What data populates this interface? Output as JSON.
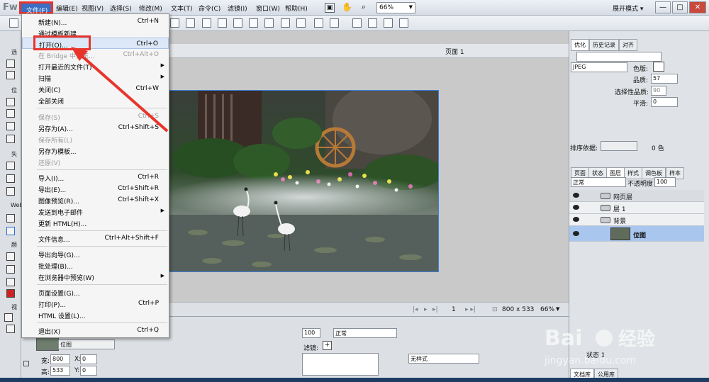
{
  "app": {
    "logo": "Fw"
  },
  "menubar": {
    "items": [
      {
        "label": "文件(F)"
      },
      {
        "label": "编辑(E)"
      },
      {
        "label": "视图(V)"
      },
      {
        "label": "选择(S)"
      },
      {
        "label": "修改(M)"
      },
      {
        "label": "文本(T)"
      },
      {
        "label": "命令(C)"
      },
      {
        "label": "滤镜(I)"
      },
      {
        "label": "窗口(W)"
      },
      {
        "label": "帮助(H)"
      }
    ],
    "zoom": "66%",
    "layout_mode": "展开模式",
    "min": "—",
    "max": "□",
    "close": "✕"
  },
  "file_menu": {
    "items": [
      {
        "label": "新建(N)...",
        "shortcut": "Ctrl+N"
      },
      {
        "label": "通过模板新建...",
        "shortcut": ""
      },
      {
        "label": "打开(O)...",
        "shortcut": "Ctrl+O"
      },
      {
        "label": "在 Bridge 中浏览...",
        "shortcut": "Ctrl+Alt+O"
      },
      {
        "label": "打开最近的文件(T)",
        "shortcut": ""
      },
      {
        "label": "扫描",
        "shortcut": ""
      },
      {
        "label": "关闭(C)",
        "shortcut": "Ctrl+W"
      },
      {
        "label": "全部关闭",
        "shortcut": ""
      },
      {
        "label": "保存(S)",
        "shortcut": "Ctrl+S"
      },
      {
        "label": "另存为(A)...",
        "shortcut": "Ctrl+Shift+S"
      },
      {
        "label": "保存所有(L)",
        "shortcut": ""
      },
      {
        "label": "另存为模板...",
        "shortcut": ""
      },
      {
        "label": "还原(V)",
        "shortcut": ""
      },
      {
        "label": "导入(I)...",
        "shortcut": "Ctrl+R"
      },
      {
        "label": "导出(E)...",
        "shortcut": "Ctrl+Shift+R"
      },
      {
        "label": "图像预览(R)...",
        "shortcut": "Ctrl+Shift+X"
      },
      {
        "label": "发送到电子邮件",
        "shortcut": ""
      },
      {
        "label": "更新 HTML(H)...",
        "shortcut": ""
      },
      {
        "label": "文件信息...",
        "shortcut": "Ctrl+Alt+Shift+F"
      },
      {
        "label": "导出向导(G)...",
        "shortcut": ""
      },
      {
        "label": "批处理(B)...",
        "shortcut": ""
      },
      {
        "label": "在浏览器中预览(W)",
        "shortcut": ""
      },
      {
        "label": "页面设置(G)...",
        "shortcut": ""
      },
      {
        "label": "打印(P)...",
        "shortcut": "Ctrl+P"
      },
      {
        "label": "HTML 设置(L)...",
        "shortcut": ""
      },
      {
        "label": "退出(X)",
        "shortcut": "Ctrl+Q"
      }
    ]
  },
  "tools": {
    "labels": [
      "选",
      "位",
      "矢",
      "Web",
      "颜",
      "视"
    ]
  },
  "document": {
    "page": "页面 1",
    "frame": "1",
    "size": "800 x 533",
    "zoom": "66%"
  },
  "properties": {
    "object_name": "位图",
    "width_label": "宽:",
    "width": "800",
    "height_label": "高:",
    "height": "533",
    "x_label": "X:",
    "x": "0",
    "y_label": "Y:",
    "y": "0",
    "opacity": "100",
    "blend": "正常",
    "filters_label": "滤镜:",
    "style": "无样式"
  },
  "right_panel": {
    "top_tabs": [
      "优化",
      "历史记录",
      "对齐"
    ],
    "format": "JPEG",
    "matte_label": "色版:",
    "quality_label": "品质:",
    "quality": "57",
    "selective_label": "选择性品质:",
    "selective": "90",
    "smoothing_label": "平滑:",
    "smoothing": "0",
    "sort_label": "排序依据:",
    "color_count": "0 色",
    "layer_tabs": [
      "页面",
      "状态",
      "图层",
      "样式",
      "调色板",
      "样本"
    ],
    "blend": "正常",
    "opacity_label": "不透明度",
    "opacity": "100",
    "layers": [
      {
        "name": "网页层"
      },
      {
        "name": "层 1"
      },
      {
        "name": "背景"
      },
      {
        "name": "位图"
      }
    ],
    "state_label": "状态 1",
    "bottom_tabs": [
      "文档库",
      "公用库"
    ]
  },
  "watermark": {
    "brand": "Bai",
    "brand2": "经验",
    "url": "jingyan.baidu.com"
  },
  "colors": {
    "highlight_red": "#e8342b",
    "menu_selected": "#3c6fc4",
    "selection_blue": "#3c7fd9"
  }
}
